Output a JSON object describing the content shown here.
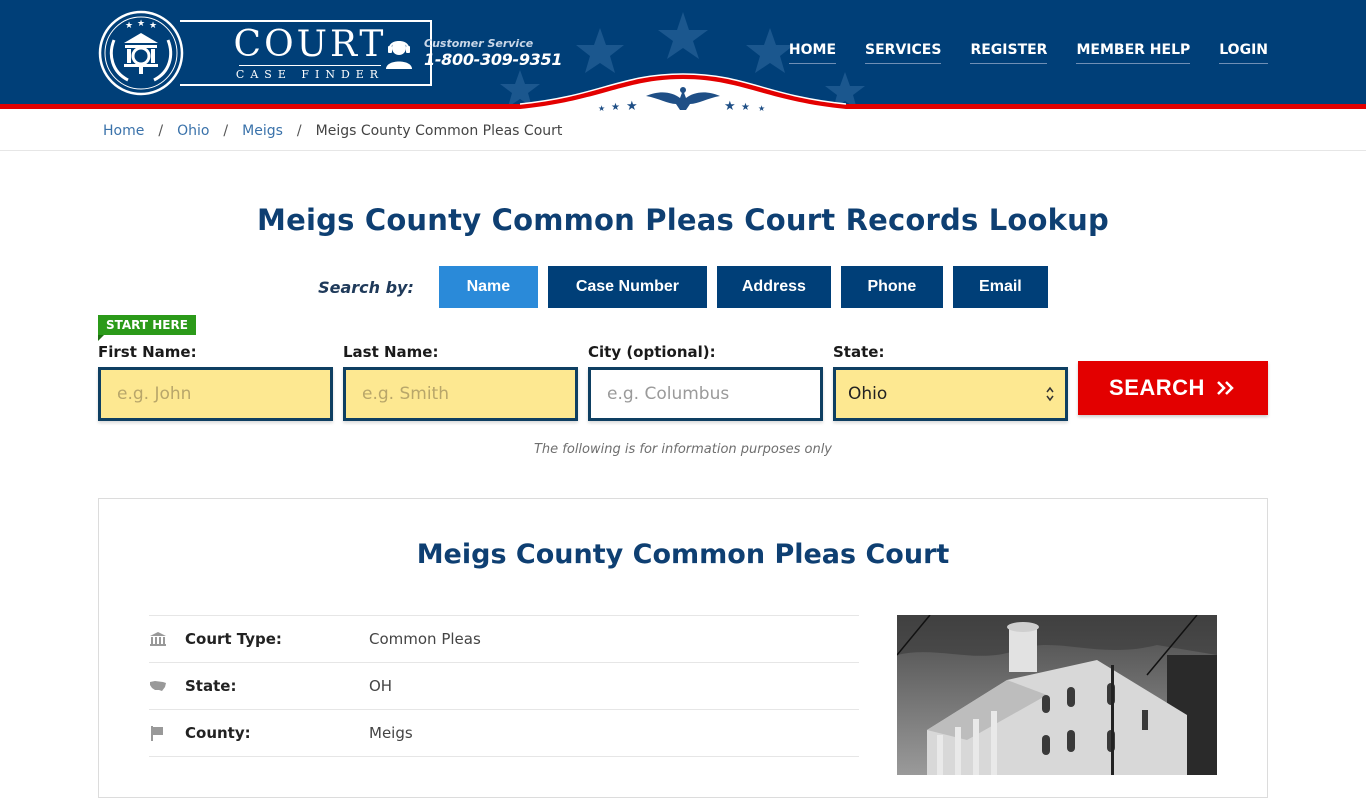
{
  "header": {
    "logo": {
      "title": "COURT",
      "subtitle": "CASE FINDER"
    },
    "customer_service": {
      "label": "Customer Service",
      "phone": "1-800-309-9351"
    },
    "nav": [
      {
        "label": "HOME"
      },
      {
        "label": "SERVICES"
      },
      {
        "label": "REGISTER"
      },
      {
        "label": "MEMBER HELP"
      },
      {
        "label": "LOGIN"
      }
    ],
    "colors": {
      "navy": "#003f78",
      "red": "#e30000"
    }
  },
  "breadcrumb": [
    {
      "label": "Home"
    },
    {
      "label": "Ohio"
    },
    {
      "label": "Meigs"
    },
    {
      "label": "Meigs County Common Pleas Court"
    }
  ],
  "page_title": "Meigs County Common Pleas Court Records Lookup",
  "search_by": {
    "label": "Search by:",
    "options": [
      {
        "label": "Name",
        "active": true
      },
      {
        "label": "Case Number",
        "active": false
      },
      {
        "label": "Address",
        "active": false
      },
      {
        "label": "Phone",
        "active": false
      },
      {
        "label": "Email",
        "active": false
      }
    ]
  },
  "form": {
    "badge": "START HERE",
    "first_name": {
      "label": "First Name:",
      "placeholder": "e.g. John",
      "value": ""
    },
    "last_name": {
      "label": "Last Name:",
      "placeholder": "e.g. Smith",
      "value": ""
    },
    "city": {
      "label": "City (optional):",
      "placeholder": "e.g.  Columbus",
      "value": ""
    },
    "state": {
      "label": "State:",
      "value": "Ohio"
    },
    "search_button": "SEARCH",
    "search_button_icon": "double-chevron-right"
  },
  "disclaimer": "The following is for information purposes only",
  "court": {
    "name": "Meigs County Common Pleas Court",
    "details": [
      {
        "icon": "courthouse-icon",
        "key": "Court Type:",
        "value": "Common Pleas"
      },
      {
        "icon": "us-map-icon",
        "key": "State:",
        "value": "OH"
      },
      {
        "icon": "flag-icon",
        "key": "County:",
        "value": "Meigs"
      }
    ],
    "photo_alt": "Meigs County courthouse (black and white)"
  }
}
